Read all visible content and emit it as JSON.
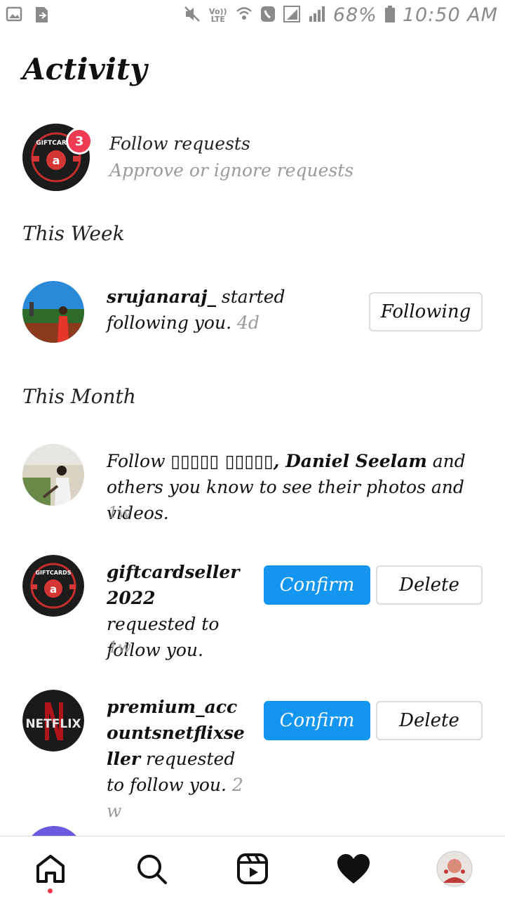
{
  "status_bar": {
    "lte_label": "Vo)) LTE",
    "battery": "68%",
    "time": "10:50 AM"
  },
  "header": {
    "title": "Activity"
  },
  "follow_requests": {
    "title": "Follow requests",
    "subtitle": "Approve or ignore requests",
    "badge_count": "3"
  },
  "sections": {
    "this_week": "This Week",
    "this_month": "This Month"
  },
  "week_items": [
    {
      "username": "srujanaraj_",
      "text": " started following you.",
      "time": "4d",
      "button": "Following"
    }
  ],
  "month_items": [
    {
      "prefix": "Follow ",
      "names": "▯▯▯▯▯ ▯▯▯▯▯, Daniel Seelam",
      "suffix": " and others you know to see their photos and videos.",
      "time": "1w"
    },
    {
      "username": "giftcardseller 2022",
      "text": " requested to follow you.",
      "time": "1w",
      "confirm": "Confirm",
      "delete": "Delete"
    },
    {
      "username": "premium_accountsnetflixseller",
      "text": " requested to follow you.",
      "time": "2w",
      "confirm": "Confirm",
      "delete": "Delete"
    }
  ],
  "avatar_labels": {
    "giftcards": "GIFTCARDS",
    "netflix": "NETFLIX"
  },
  "bottom_nav": {
    "items": [
      "home-icon",
      "search-icon",
      "reels-icon",
      "activity-heart-icon",
      "profile-avatar"
    ]
  },
  "colors": {
    "accent": "#1496f0",
    "badge": "#ef3b52",
    "muted": "#9a9a9a"
  }
}
